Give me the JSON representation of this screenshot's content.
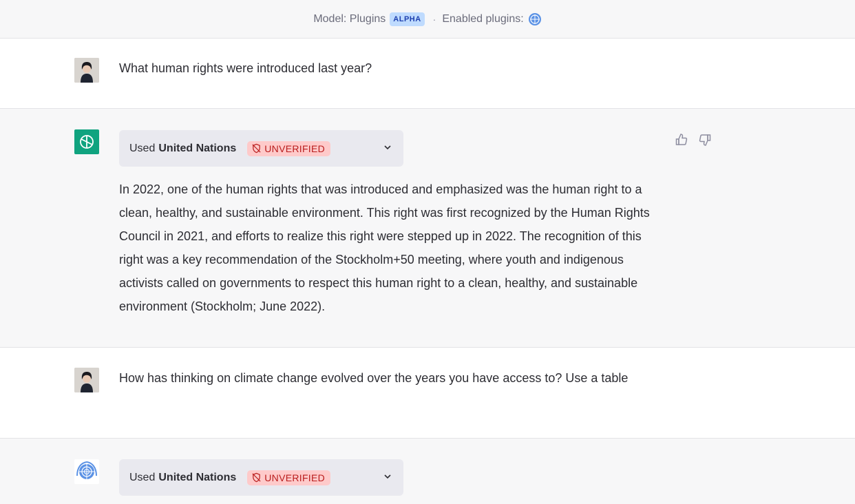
{
  "topbar": {
    "model_label": "Model: Plugins",
    "alpha_badge": "ALPHA",
    "separator": "·",
    "enabled_plugins_label": "Enabled plugins:",
    "plugin_icon": "united-nations-icon"
  },
  "conversation": [
    {
      "role": "user",
      "avatar": "user-photo-avatar",
      "text": "What human rights were introduced last year?"
    },
    {
      "role": "assistant",
      "avatar": "chatgpt-logo-icon",
      "plugin": {
        "used_prefix": "Used",
        "plugin_name": "United Nations",
        "status": "UNVERIFIED",
        "status_icon": "unverified-shield-icon",
        "expand_icon": "chevron-down-icon"
      },
      "text": "In 2022, one of the human rights that was introduced and emphasized was the human right to a clean, healthy, and sustainable environment. This right was first recognized by the Human Rights Council in 2021, and efforts to realize this right were stepped up in 2022. The recognition of this right was a key recommendation of the Stockholm+50 meeting, where youth and indigenous activists called on governments to respect this human right to a clean, healthy, and sustainable environment (Stockholm; June 2022).",
      "feedback_icons": [
        "thumbs-up-icon",
        "thumbs-down-icon"
      ]
    },
    {
      "role": "user",
      "avatar": "user-photo-avatar",
      "text": "How has thinking on climate change evolved over the years you have access to? Use a table"
    },
    {
      "role": "assistant",
      "avatar": "united-nations-logo-icon",
      "plugin": {
        "used_prefix": "Used",
        "plugin_name": "United Nations",
        "status": "UNVERIFIED",
        "status_icon": "unverified-shield-icon",
        "expand_icon": "chevron-down-icon"
      }
    }
  ],
  "colors": {
    "assistant_bg": "#f7f7f8",
    "chatgpt_green": "#10a37f",
    "alpha_badge_bg": "#bfdbfe",
    "unverified_bg": "#fecaca",
    "unverified_text": "#b91c1c",
    "plugin_box_bg": "#e9e9ef"
  }
}
